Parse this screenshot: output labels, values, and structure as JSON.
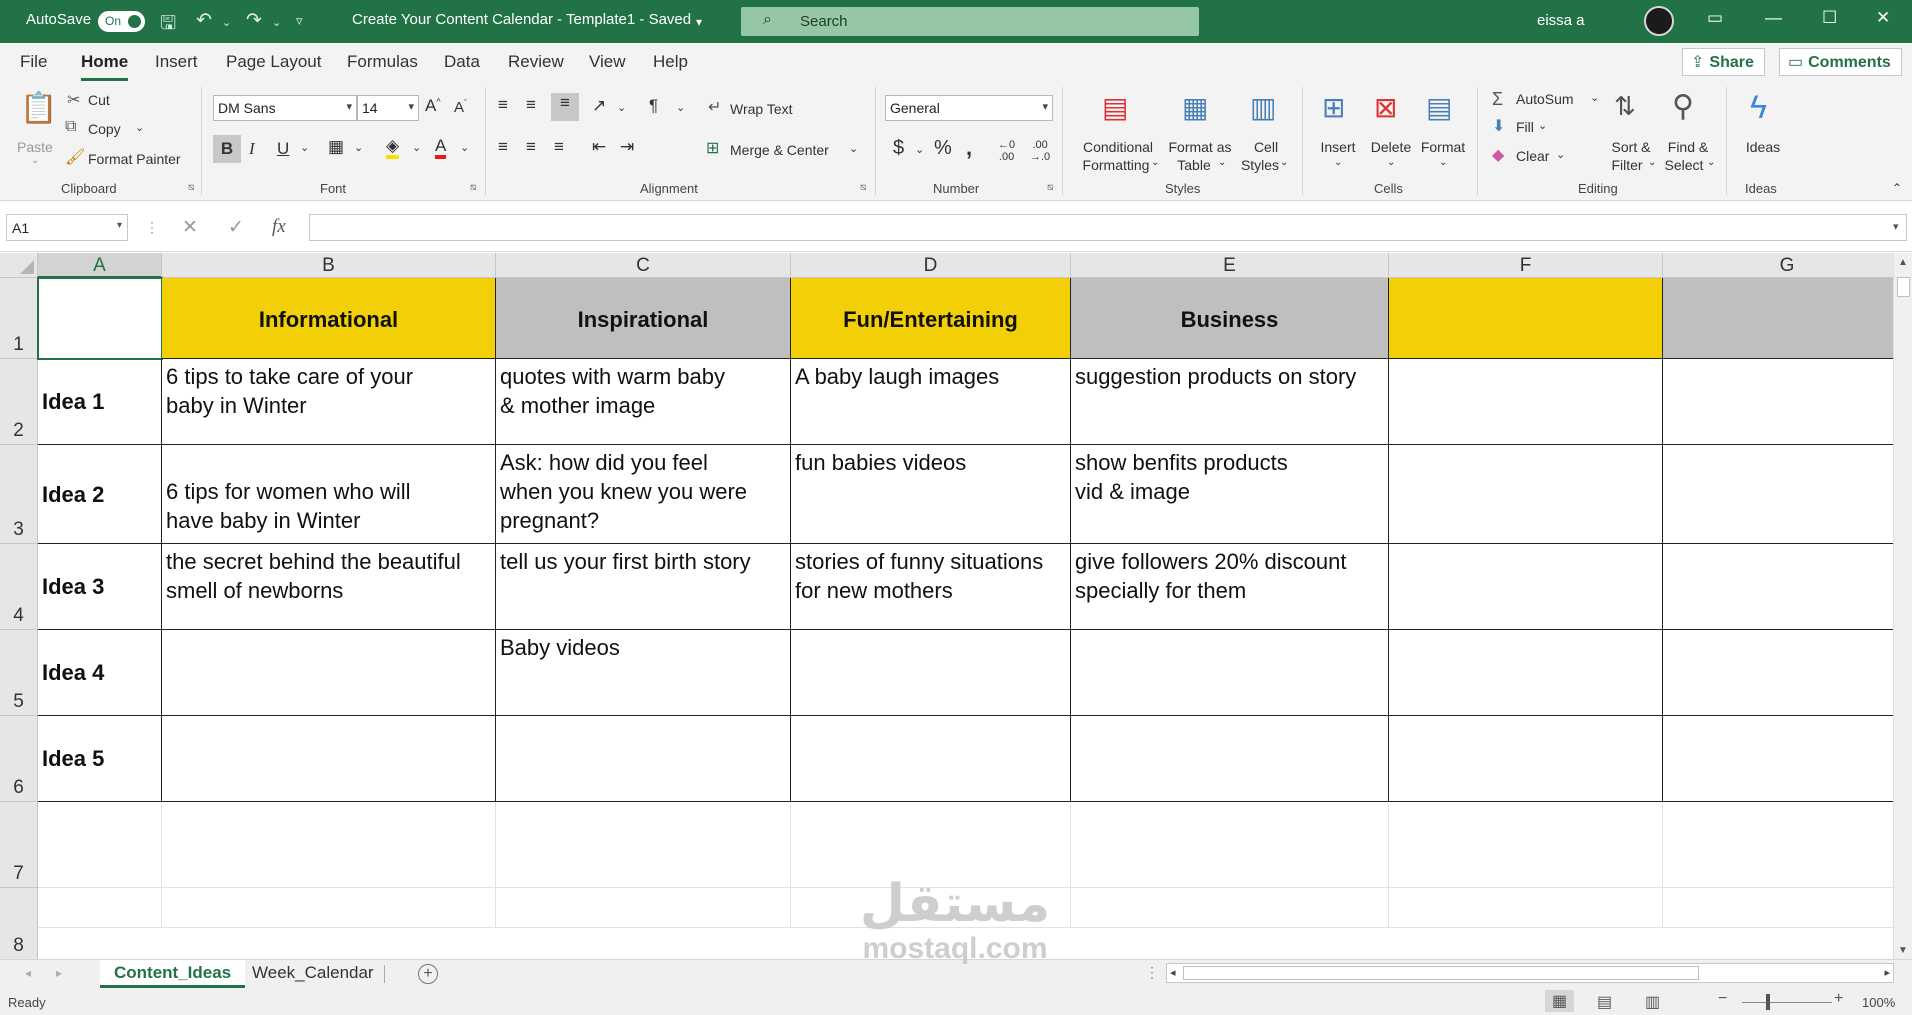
{
  "titlebar": {
    "autosave_label": "AutoSave",
    "autosave_state": "On",
    "document_title": "Create Your Content Calendar - Template1  -  Saved",
    "search_placeholder": "Search",
    "user_name": "eissa a"
  },
  "menu": {
    "tabs": [
      "File",
      "Home",
      "Insert",
      "Page Layout",
      "Formulas",
      "Data",
      "Review",
      "View",
      "Help"
    ],
    "active_tab": "Home",
    "share_label": "Share",
    "comments_label": "Comments"
  },
  "ribbon": {
    "clipboard": {
      "paste": "Paste",
      "cut": "Cut",
      "copy": "Copy",
      "format_painter": "Format Painter",
      "group_label": "Clipboard"
    },
    "font": {
      "font_name": "DM Sans",
      "font_size": "14",
      "bold": "B",
      "italic": "I",
      "underline": "U",
      "group_label": "Font"
    },
    "alignment": {
      "wrap_text": "Wrap Text",
      "merge_center": "Merge & Center",
      "group_label": "Alignment"
    },
    "number": {
      "format": "General",
      "group_label": "Number"
    },
    "styles": {
      "conditional_formatting_1": "Conditional",
      "conditional_formatting_2": "Formatting",
      "format_as_table_1": "Format as",
      "format_as_table_2": "Table",
      "cell_styles_1": "Cell",
      "cell_styles_2": "Styles",
      "group_label": "Styles"
    },
    "cells": {
      "insert": "Insert",
      "delete": "Delete",
      "format": "Format",
      "group_label": "Cells"
    },
    "editing": {
      "autosum": "AutoSum",
      "fill": "Fill",
      "clear": "Clear",
      "sort_filter_1": "Sort &",
      "sort_filter_2": "Filter",
      "find_select_1": "Find &",
      "find_select_2": "Select",
      "group_label": "Editing"
    },
    "ideas": {
      "ideas": "Ideas",
      "group_label": "Ideas"
    }
  },
  "formula_bar": {
    "name_box": "A1",
    "formula": ""
  },
  "sheet": {
    "columns": [
      "A",
      "B",
      "C",
      "D",
      "E",
      "F",
      "G"
    ],
    "rows": [
      "1",
      "2",
      "3",
      "4",
      "5",
      "6",
      "7",
      "8"
    ],
    "header_row": [
      "",
      "Informational",
      "Inspirational",
      "Fun/Entertaining",
      "Business",
      "",
      ""
    ],
    "data_rows": [
      {
        "label": "Idea 1",
        "cells": [
          "6 tips to take care of your\nbaby in Winter",
          "quotes with warm baby\n& mother image",
          "A baby laugh images",
          "suggestion products on story",
          "",
          ""
        ]
      },
      {
        "label": "Idea 2",
        "cells": [
          "\n6 tips for women who will\nhave baby in Winter",
          "Ask: how did you feel\nwhen you knew you were\npregnant?",
          "fun babies videos",
          "show benfits products\nvid & image",
          "",
          ""
        ]
      },
      {
        "label": "Idea 3",
        "cells": [
          "the secret behind the beautiful\nsmell of newborns",
          "tell us your first birth story",
          "stories of funny situations\nfor new mothers",
          "give followers 20% discount\nspecially for them",
          "",
          ""
        ]
      },
      {
        "label": "Idea 4",
        "cells": [
          "",
          "Baby videos",
          "",
          "",
          "",
          ""
        ]
      },
      {
        "label": "Idea 5",
        "cells": [
          "",
          "",
          "",
          "",
          "",
          ""
        ]
      }
    ],
    "header_fill": [
      "#ffffff",
      "#f3cf08",
      "#bfbfbf",
      "#f3cf08",
      "#bfbfbf",
      "#f3cf08",
      "#bfbfbf"
    ]
  },
  "sheet_tabs": [
    "Content_Ideas",
    "Week_Calendar"
  ],
  "active_sheet": "Content_Ideas",
  "status": {
    "ready": "Ready",
    "zoom": "100%"
  },
  "watermark": {
    "arabic": "مستقل",
    "latin": "mostaql.com"
  },
  "colors": {
    "accent": "#217346",
    "yellow": "#f3cf08",
    "grey": "#bfbfbf"
  }
}
